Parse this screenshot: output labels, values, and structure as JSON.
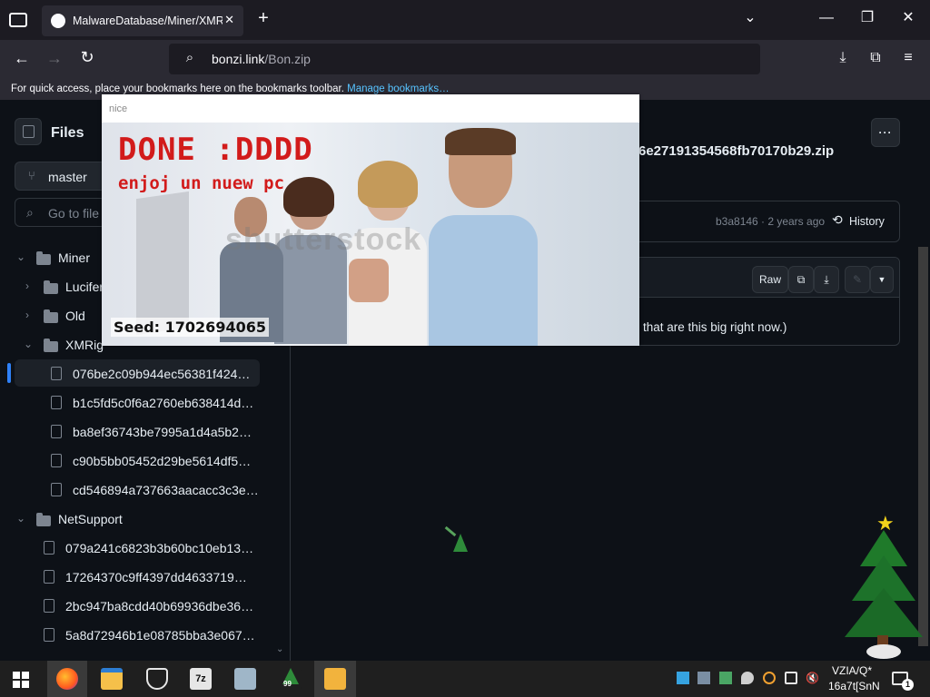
{
  "browser": {
    "tab_title": "MalwareDatabase/Miner/XMRi",
    "tab_close": "✕",
    "new_tab": "+",
    "url_host": "bonzi.link",
    "url_path": "/Bon.zip",
    "bookmarks_hint": "For quick access, place your bookmarks here on the bookmarks toolbar.",
    "bookmarks_link": "Manage bookmarks…"
  },
  "sidebar": {
    "title": "Files",
    "branch": "master",
    "search_placeholder": "Go to file",
    "tree": [
      {
        "label": "Miner",
        "kind": "folder",
        "expanded": true
      },
      {
        "label": "Lucifer",
        "kind": "folder",
        "expanded": false
      },
      {
        "label": "Old",
        "kind": "folder",
        "expanded": false
      },
      {
        "label": "XMRig",
        "kind": "folder",
        "expanded": true
      },
      {
        "label": "076be2c09b944ec56381f424…",
        "kind": "file",
        "selected": true
      },
      {
        "label": "b1c5fd5c0f6a2760eb638414d…",
        "kind": "file"
      },
      {
        "label": "ba8ef36743be7995a1d4a5b2…",
        "kind": "file"
      },
      {
        "label": "c90b5bb05452d29be5614df5…",
        "kind": "file"
      },
      {
        "label": "cd546894a737663aacacc3c3e…",
        "kind": "file"
      },
      {
        "label": "NetSupport",
        "kind": "folder",
        "expanded": true
      },
      {
        "label": "079a241c6823b3b60bc10eb13…",
        "kind": "file"
      },
      {
        "label": "17264370c9ff4397dd4633719…",
        "kind": "file"
      },
      {
        "label": "2bc947ba8cdd40b69936dbe36…",
        "kind": "file"
      },
      {
        "label": "5a8d72946b1e08785bba3e067…",
        "kind": "file"
      }
    ]
  },
  "main": {
    "file_title": "6e27191354568fb70170b29.zip",
    "commit_hash": "b3a8146",
    "commit_age": "· 2 years ago",
    "history_label": "History",
    "raw_label": "Raw",
    "notice": "that are this big right now.)",
    "more_label": "···"
  },
  "popup": {
    "title": "nice",
    "headline": "DONE :DDDD",
    "subline": "enjoj un nuew pc",
    "watermark": "shutterstock",
    "seed": "Seed: 1702694065"
  },
  "taskbar": {
    "tray_text_1": "VZIA/Q*",
    "tray_text_2": "16a7t[SnN",
    "notification_count": "1",
    "tree_badge": "99"
  },
  "colors": {
    "accent_link": "#57c3ff",
    "headline_red": "#d21b1b",
    "selected_marker": "#2f81f7"
  }
}
